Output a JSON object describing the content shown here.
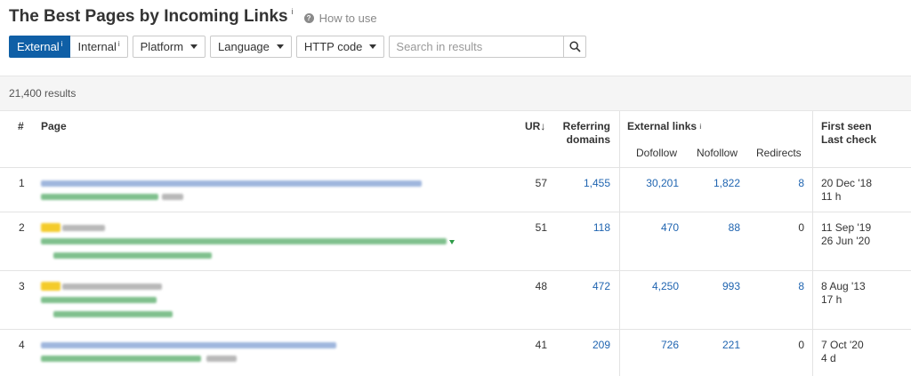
{
  "header": {
    "title": "The Best Pages by Incoming Links",
    "title_info": "i",
    "how_to_use": "How to use"
  },
  "controls": {
    "external_label": "External",
    "external_info": "i",
    "internal_label": "Internal",
    "internal_info": "i",
    "platform_label": "Platform",
    "language_label": "Language",
    "http_code_label": "HTTP code",
    "search_placeholder": "Search in results"
  },
  "results": {
    "count_text": "21,400 results"
  },
  "table": {
    "headers": {
      "index": "#",
      "page": "Page",
      "ur": "UR",
      "ur_sort": "↓",
      "referring_domains_line1": "Referring",
      "referring_domains_line2": "domains",
      "external_links": "External links",
      "external_links_info": "i",
      "dofollow": "Dofollow",
      "nofollow": "Nofollow",
      "redirects": "Redirects",
      "first_seen": "First seen",
      "last_check": "Last check"
    },
    "rows": [
      {
        "index": "1",
        "ur": "57",
        "referring_domains": "1,455",
        "dofollow": "30,201",
        "nofollow": "1,822",
        "redirects": "8",
        "first_seen": "20 Dec '18",
        "last_check": "11 h"
      },
      {
        "index": "2",
        "ur": "51",
        "referring_domains": "118",
        "dofollow": "470",
        "nofollow": "88",
        "redirects": "0",
        "first_seen": "11 Sep '19",
        "last_check": "26 Jun '20"
      },
      {
        "index": "3",
        "ur": "48",
        "referring_domains": "472",
        "dofollow": "4,250",
        "nofollow": "993",
        "redirects": "8",
        "first_seen": "8 Aug '13",
        "last_check": "17 h"
      },
      {
        "index": "4",
        "ur": "41",
        "referring_domains": "209",
        "dofollow": "726",
        "nofollow": "221",
        "redirects": "0",
        "first_seen": "7 Oct '20",
        "last_check": "4 d"
      }
    ]
  },
  "colors": {
    "accent": "#0f5fa6",
    "link": "#1f64b0",
    "redirect_nonzero": "#1f64b0"
  }
}
